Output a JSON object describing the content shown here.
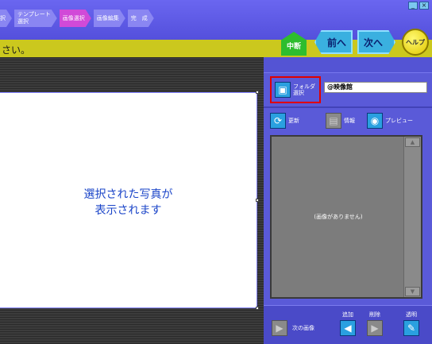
{
  "window": {
    "minimize_label": "_",
    "close_label": "×"
  },
  "steps": [
    {
      "label": "択"
    },
    {
      "label": "テンプレート\n選択"
    },
    {
      "label": "画像選択"
    },
    {
      "label": "画像編集"
    },
    {
      "label": "完　成"
    }
  ],
  "instruction": {
    "text": "さい。"
  },
  "nav": {
    "home_label": "中断",
    "prev_label": "前へ",
    "next_label": "次へ",
    "help_label": "ヘルプ"
  },
  "preview": {
    "line1": "選択された写真が",
    "line2": "表示されます"
  },
  "folder": {
    "button_label": "フォルダ\n選択",
    "path": "@映像館"
  },
  "toolbar": {
    "refresh_label": "更新",
    "info_label": "情報",
    "preview_label": "プレビュー"
  },
  "list": {
    "empty_text": "(画像がありません)"
  },
  "bottom": {
    "next_image_label": "次の画像",
    "add_label": "追加",
    "delete_label": "削除",
    "transparent_label": "透明"
  },
  "colors": {
    "header": "#5450dc",
    "instruction_bar": "#cbc81e",
    "active_step": "#d14ad8",
    "highlight": "#e00000"
  }
}
